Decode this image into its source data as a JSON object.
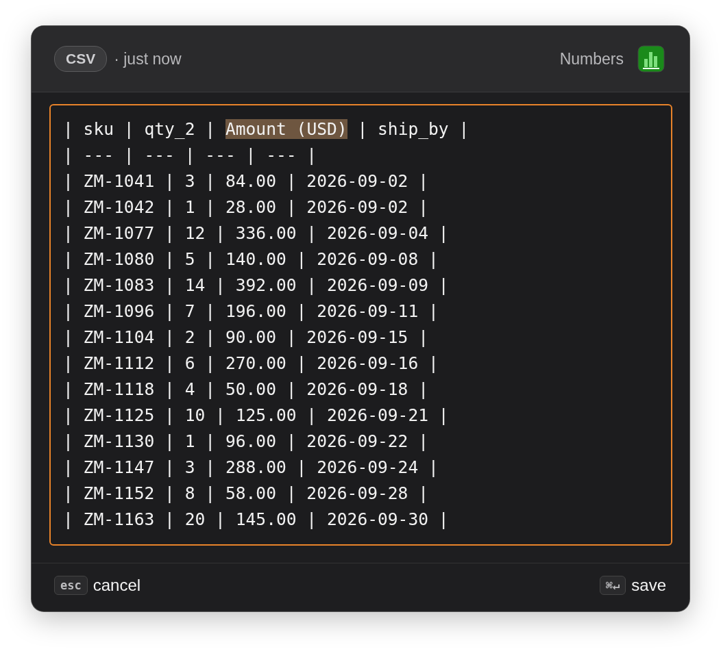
{
  "header": {
    "format_badge": "CSV",
    "timestamp": "· just now",
    "app_name": "Numbers"
  },
  "editor": {
    "focused": true,
    "lines": [
      [
        {
          "text": "| sku | qty_2 | ",
          "highlighted": false
        },
        {
          "text": "Amount (USD)",
          "highlighted": true
        },
        {
          "text": " | ship_by |",
          "highlighted": false
        }
      ],
      [
        {
          "text": "| --- | --- | --- | --- |",
          "highlighted": false
        }
      ],
      [
        {
          "text": "| ZM-1041 | 3 | 84.00 | 2026-09-02 |",
          "highlighted": false
        }
      ],
      [
        {
          "text": "| ZM-1042 | 1 | 28.00 | 2026-09-02 |",
          "highlighted": false
        }
      ],
      [
        {
          "text": "| ZM-1077 | 12 | 336.00 | 2026-09-04 |",
          "highlighted": false
        }
      ],
      [
        {
          "text": "| ZM-1080 | 5 | 140.00 | 2026-09-08 |",
          "highlighted": false
        }
      ],
      [
        {
          "text": "| ZM-1083 | 14 | 392.00 | 2026-09-09 |",
          "highlighted": false
        }
      ],
      [
        {
          "text": "| ZM-1096 | 7 | 196.00 | 2026-09-11 |",
          "highlighted": false
        }
      ],
      [
        {
          "text": "| ZM-1104 | 2 | 90.00 | 2026-09-15 |",
          "highlighted": false
        }
      ],
      [
        {
          "text": "| ZM-1112 | 6 | 270.00 | 2026-09-16 |",
          "highlighted": false
        }
      ],
      [
        {
          "text": "| ZM-1118 | 4 | 50.00 | 2026-09-18 |",
          "highlighted": false
        }
      ],
      [
        {
          "text": "| ZM-1125 | 10 | 125.00 | 2026-09-21 |",
          "highlighted": false
        }
      ],
      [
        {
          "text": "| ZM-1130 | 1 | 96.00 | 2026-09-22 |",
          "highlighted": false
        }
      ],
      [
        {
          "text": "| ZM-1147 | 3 | 288.00 | 2026-09-24 |",
          "highlighted": false
        }
      ],
      [
        {
          "text": "| ZM-1152 | 8 | 58.00 | 2026-09-28 |",
          "highlighted": false
        }
      ],
      [
        {
          "text": "| ZM-1163 | 20 | 145.00 | 2026-09-30 |",
          "highlighted": false
        }
      ]
    ]
  },
  "footer": {
    "cancel": {
      "key": "esc",
      "label": "cancel"
    },
    "save": {
      "key": "⌘↵",
      "label": "save"
    }
  }
}
